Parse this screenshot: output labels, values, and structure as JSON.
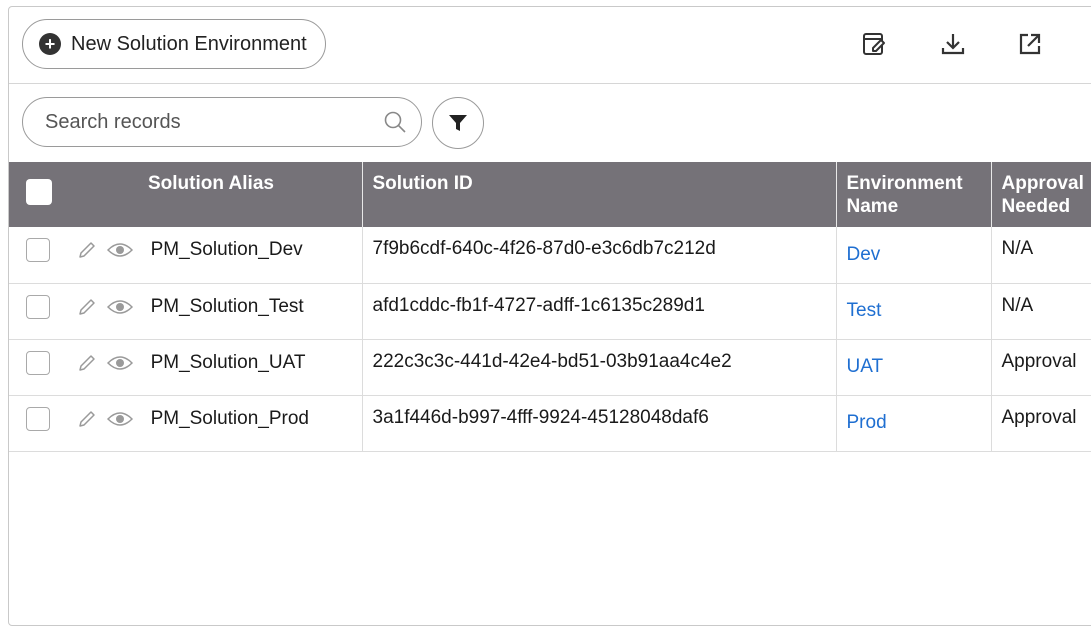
{
  "toolbar": {
    "new_button_label": "New Solution Environment",
    "icons": [
      "edit-note-icon",
      "download-icon",
      "open-external-icon"
    ]
  },
  "search": {
    "placeholder": "Search records",
    "value": ""
  },
  "table": {
    "columns": [
      "Solution Alias",
      "Solution ID",
      "Environment Name",
      "Approval Needed"
    ],
    "rows": [
      {
        "alias": "PM_Solution_Dev",
        "id": "7f9b6cdf-640c-4f26-87d0-e3c6db7c212d",
        "env": "Dev",
        "approval": "N/A"
      },
      {
        "alias": "PM_Solution_Test",
        "id": "afd1cddc-fb1f-4727-adff-1c6135c289d1",
        "env": "Test",
        "approval": "N/A"
      },
      {
        "alias": "PM_Solution_UAT",
        "id": "222c3c3c-441d-42e4-bd51-03b91aa4c4e2",
        "env": "UAT",
        "approval": "Approval"
      },
      {
        "alias": "PM_Solution_Prod",
        "id": "3a1f446d-b997-4fff-9924-45128048daf6",
        "env": "Prod",
        "approval": "Approval"
      }
    ]
  },
  "colors": {
    "header_bg": "#757278",
    "link": "#1f6fd1",
    "border": "#c9c9c9"
  }
}
